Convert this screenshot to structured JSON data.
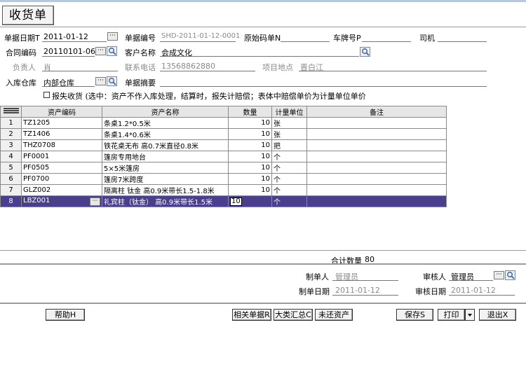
{
  "title": "收货单",
  "header": {
    "doc_date_label": "单据日期T",
    "doc_date": "2011-01-12",
    "doc_no_label": "单据编号",
    "doc_no": "SHD-2011-01-12-0001",
    "orig_no_label": "原始码单N",
    "plate_label": "车牌号P",
    "driver_label": "司机",
    "contract_label": "合同编码",
    "contract": "20110101-06",
    "customer_label": "客户名称",
    "customer": "会成文化",
    "manager_label": "负责人",
    "manager": "肖",
    "phone_label": "联系电话",
    "phone": "13568862880",
    "project_label": "项目地点",
    "project": "晋白江",
    "warehouse_label": "入库仓库",
    "warehouse": "内部仓库",
    "summary_label": "单据摘要",
    "loss_text": "报失收货 (选中：资产不作入库处理，结算时，报失计赔偿；表体中赔偿单价为计量单位单价"
  },
  "grid": {
    "columns": [
      "资产编码",
      "资产名称",
      "数量",
      "计量单位",
      "备注"
    ],
    "rows": [
      {
        "n": "1",
        "code": "TZ1205",
        "name": "条桌1.2*0.5米",
        "qty": "10",
        "unit": "张",
        "note": ""
      },
      {
        "n": "2",
        "code": "TZ1406",
        "name": "条桌1.4*0.6米",
        "qty": "10",
        "unit": "张",
        "note": ""
      },
      {
        "n": "3",
        "code": "THZ0708",
        "name": "铁花桌无布 高0.7米直径0.8米",
        "qty": "10",
        "unit": "把",
        "note": ""
      },
      {
        "n": "4",
        "code": "PF0001",
        "name": "篷房专用地台",
        "qty": "10",
        "unit": "个",
        "note": ""
      },
      {
        "n": "5",
        "code": "PF0505",
        "name": "5×5米篷房",
        "qty": "10",
        "unit": "个",
        "note": ""
      },
      {
        "n": "6",
        "code": "PF0700",
        "name": "篷房7米跨度",
        "qty": "10",
        "unit": "个",
        "note": ""
      },
      {
        "n": "7",
        "code": "GLZ002",
        "name": "隔离柱 钛金 高0.9米带长1.5-1.8米",
        "qty": "10",
        "unit": "个",
        "note": ""
      },
      {
        "n": "8",
        "code": "LBZ001",
        "name": "礼宾柱（钛金） 高0.9米带长1.5米",
        "qty": "10",
        "unit": "个",
        "note": ""
      }
    ]
  },
  "total": {
    "label": "合计数量",
    "value": "80"
  },
  "footer": {
    "maker_label": "制单人",
    "maker": "管理员",
    "auditor_label": "审核人",
    "auditor": "管理员",
    "make_date_label": "制单日期",
    "make_date": "2011-01-12",
    "audit_date_label": "审核日期",
    "audit_date": "2011-01-12"
  },
  "buttons": {
    "help": "帮助H",
    "related": "相关单据R",
    "category": "大类汇总C",
    "unreturned": "未还资产",
    "save": "保存S",
    "print": "打印",
    "exit": "退出X"
  },
  "colors": {
    "selected_row": "#4a3f8c",
    "header_bg": "#e6e6e6"
  }
}
